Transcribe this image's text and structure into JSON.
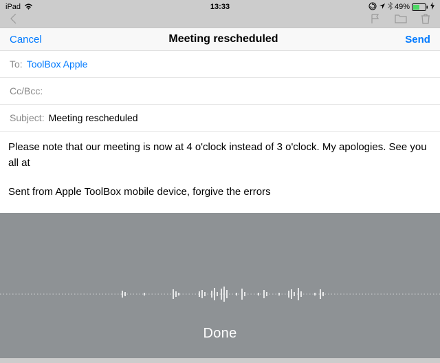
{
  "status": {
    "device": "iPad",
    "time": "13:33",
    "battery_pct": "49%"
  },
  "compose": {
    "cancel": "Cancel",
    "title": "Meeting rescheduled",
    "send": "Send",
    "to_label": "To:",
    "to_value": "ToolBox Apple",
    "ccbcc_label": "Cc/Bcc:",
    "subject_label": "Subject:",
    "subject_value": "Meeting rescheduled",
    "body": "Please note that our meeting is now at 4 o'clock instead of 3 o'clock. My apologies. See you all at",
    "signature": "Sent from Apple ToolBox mobile device, forgive the errors"
  },
  "dictation": {
    "done": "Done"
  }
}
